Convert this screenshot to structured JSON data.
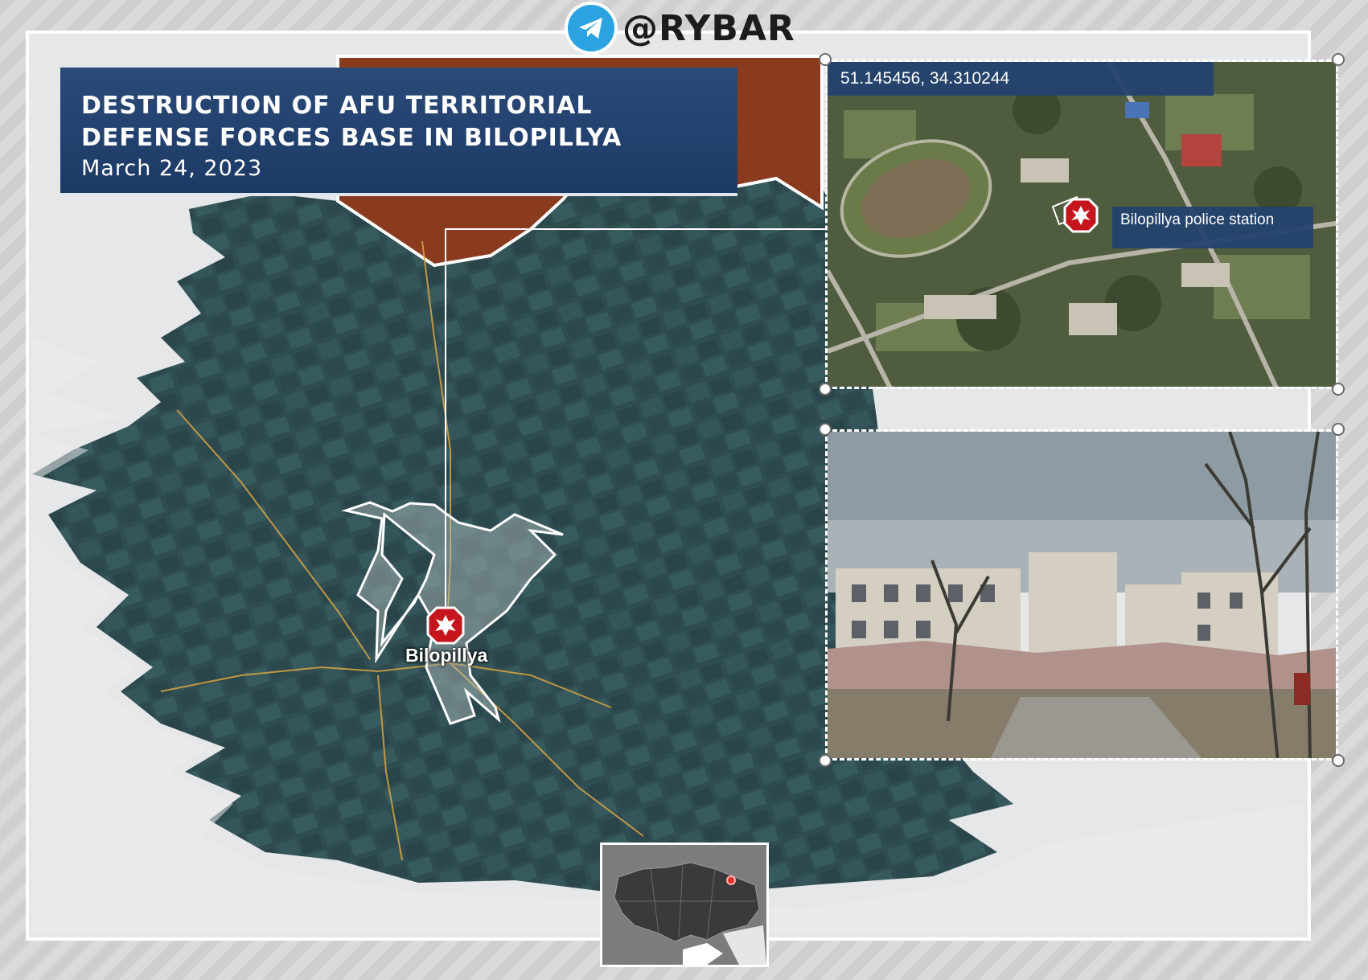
{
  "brand": {
    "handle": "@RYBAR",
    "icon": "telegram-icon"
  },
  "title": "DESTRUCTION OF AFU TERRITORIAL DEFENSE FORCES BASE IN BILOPILLYA",
  "date": "March 24, 2023",
  "map": {
    "city_label": "Bilopillya",
    "marker_icon": "explosion-icon",
    "watermark": "@RYBAR"
  },
  "satellite": {
    "coordinates": "51.145456, 34.310244",
    "label": "Bilopillya police station",
    "marker_icon": "explosion-icon"
  },
  "photo": {
    "subject": "destroyed-building"
  },
  "inset": {
    "region": "ukraine-overview",
    "highlight_icon": "location-dot-icon"
  },
  "colors": {
    "map_teal": "#2d4b4f",
    "enemy_area": "#8a3a1d",
    "title_bg": "#1d3a66",
    "marker_red": "#c4161c",
    "roads": "#d9a441"
  }
}
